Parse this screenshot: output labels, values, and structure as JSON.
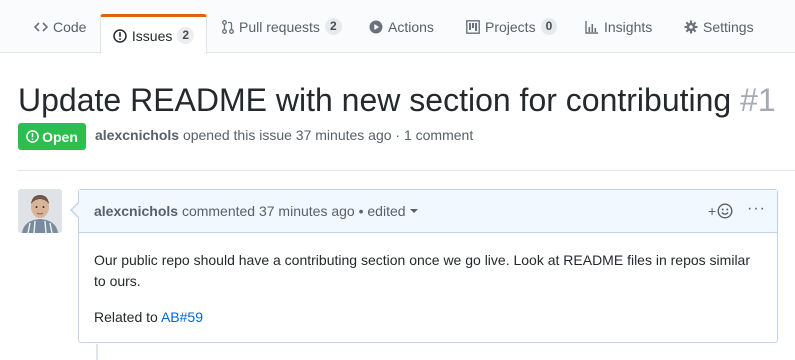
{
  "tabs": [
    {
      "label": "Code",
      "icon": "code-icon"
    },
    {
      "label": "Issues",
      "icon": "issue-opened-icon",
      "count": "2",
      "selected": true
    },
    {
      "label": "Pull requests",
      "icon": "git-pull-request-icon",
      "count": "2"
    },
    {
      "label": "Actions",
      "icon": "play-icon"
    },
    {
      "label": "Projects",
      "icon": "project-icon",
      "count": "0"
    },
    {
      "label": "Insights",
      "icon": "graph-icon"
    },
    {
      "label": "Settings",
      "icon": "gear-icon"
    }
  ],
  "issue": {
    "title": "Update README with new section for contributing",
    "number": "#1",
    "state": "Open",
    "author": "alexcnichols",
    "meta_rest": "opened this issue 37 minutes ago · 1 comment"
  },
  "comment": {
    "author": "alexcnichols",
    "action": "commented 37 minutes ago",
    "edited": "• edited",
    "reaction": "+",
    "more": "···",
    "body": "Our public repo should have a contributing section once we go live. Look at README files in repos similar to ours.",
    "related_prefix": "Related to",
    "related_link": "AB#59"
  },
  "colors": {
    "tab_accent": "#e36209",
    "open_green": "#2cbe4e",
    "link_blue": "#0366d6",
    "comment_header_bg": "#f1f8ff"
  }
}
